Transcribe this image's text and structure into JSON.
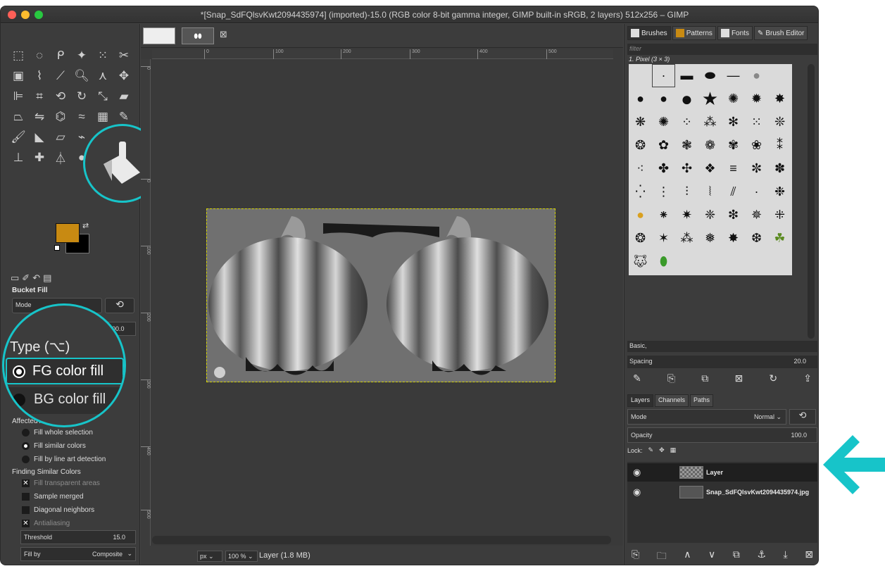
{
  "window": {
    "title": "*[Snap_SdFQlsvKwt2094435974] (imported)-15.0 (RGB color 8-bit gamma integer, GIMP built-in sRGB, 2 layers) 512x256 – GIMP"
  },
  "colors": {
    "accent": "#17c4c9",
    "foreground": "#c88a12",
    "background": "#000000",
    "ui_bg": "#3c3c3c"
  },
  "toolbox": {
    "tools": [
      "rect-select",
      "ellipse-select",
      "free-select",
      "fuzzy-select",
      "color-select",
      "scissors",
      "foreground-select",
      "paths",
      "color-picker",
      "zoom",
      "measure",
      "move",
      "align",
      "crop",
      "unified-transform",
      "rotate",
      "scale",
      "shear",
      "perspective",
      "flip",
      "cage",
      "warp",
      "gradient",
      "pencil",
      "paintbrush",
      "bucket-fill",
      "eraser",
      "airbrush",
      "ink",
      "mypaint",
      "clone",
      "heal",
      "perspective-clone",
      "blur",
      "smudge",
      "dodge"
    ],
    "tool_options": {
      "title": "Bucket Fill",
      "mode_label": "Mode",
      "opacity_value": "100.0",
      "type_label": "Type  (⌥)",
      "fg_fill": "FG color fill",
      "bg_fill": "BG color fill",
      "affected_label": "Affected Area",
      "affected": [
        "Fill whole selection",
        "Fill similar colors",
        "Fill by line art detection"
      ],
      "affected_selected": 1,
      "finding_label": "Finding Similar Colors",
      "fill_transparent": "Fill transparent areas",
      "sample_merged": "Sample merged",
      "diagonal": "Diagonal neighbors",
      "antialiasing": "Antialiasing",
      "threshold_label": "Threshold",
      "threshold_value": "15.0",
      "fillby_label": "Fill by",
      "fillby_value": "Composite"
    }
  },
  "canvas": {
    "ruler_ticks": [
      "0",
      "100",
      "200",
      "300",
      "400",
      "500"
    ],
    "vruler_ticks": [
      "0",
      "100",
      "200",
      "300",
      "400",
      "500"
    ],
    "unit": "px",
    "zoom": "100 %",
    "status": "Layer (1.8 MB)"
  },
  "dock": {
    "tabs": [
      "Brushes",
      "Patterns",
      "Fonts",
      "Brush Editor"
    ],
    "filter_placeholder": "filter",
    "brush_name": "1. Pixel (3 × 3)",
    "preset": "Basic,",
    "spacing_label": "Spacing",
    "spacing_value": "20.0",
    "layer_tabs": [
      "Layers",
      "Channels",
      "Paths"
    ],
    "layer_mode_label": "Mode",
    "layer_mode_value": "Normal",
    "layer_opacity_label": "Opacity",
    "layer_opacity_value": "100.0",
    "lock_label": "Lock:",
    "layers": [
      {
        "name": "Layer",
        "selected": true
      },
      {
        "name": "Snap_SdFQlsvKwt2094435974.jpg",
        "selected": false
      }
    ]
  }
}
